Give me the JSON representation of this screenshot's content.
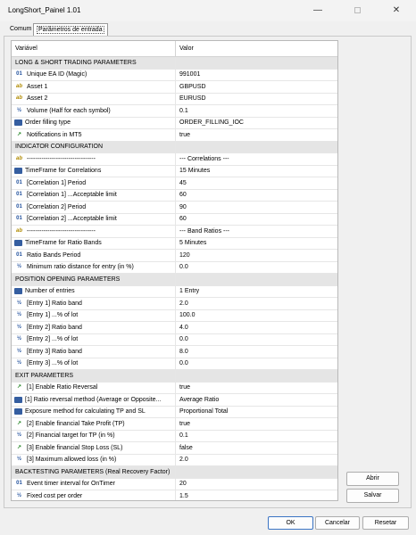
{
  "window": {
    "title": "LongShort_Painel 1.01",
    "minimize_label": "—",
    "close_label": "✕"
  },
  "tabs": [
    "Comum",
    "Parâmetros de entrada"
  ],
  "grid": {
    "headers": {
      "name": "Variável",
      "value": "Valor"
    },
    "rows": [
      {
        "name": "LONG & SHORT TRADING PARAMETERS",
        "value": "",
        "icon": "",
        "section": true
      },
      {
        "name": "Unique EA ID (Magic)",
        "value": "991001",
        "icon": "01"
      },
      {
        "name": "Asset 1",
        "value": "GBPUSD",
        "icon": "ab"
      },
      {
        "name": "Asset 2",
        "value": "EURUSD",
        "icon": "ab"
      },
      {
        "name": "Volume (Half for each symbol)",
        "value": "0.1",
        "icon": "half"
      },
      {
        "name": "Order filling type",
        "value": "ORDER_FILLING_IOC",
        "icon": "enum"
      },
      {
        "name": "Notifications in MT5",
        "value": "true",
        "icon": "bool"
      },
      {
        "name": "INDICATOR CONFIGURATION",
        "value": "",
        "icon": "",
        "section": true
      },
      {
        "name": "---------------------------------",
        "value": "--- Correlations ---",
        "icon": "ab"
      },
      {
        "name": "TimeFrame for Correlations",
        "value": "15 Minutes",
        "icon": "enum"
      },
      {
        "name": "[Correlation 1] Period",
        "value": "45",
        "icon": "01"
      },
      {
        "name": "[Correlation 1] ...Acceptable limit",
        "value": "60",
        "icon": "01"
      },
      {
        "name": "[Correlation 2] Period",
        "value": "90",
        "icon": "01"
      },
      {
        "name": "[Correlation 2] ...Acceptable limit",
        "value": "60",
        "icon": "01"
      },
      {
        "name": "---------------------------------",
        "value": "--- Band Ratios ---",
        "icon": "ab"
      },
      {
        "name": "TimeFrame for Ratio Bands",
        "value": "5 Minutes",
        "icon": "enum"
      },
      {
        "name": "Ratio Bands Period",
        "value": "120",
        "icon": "01"
      },
      {
        "name": "Minimum ratio distance for entry (in %)",
        "value": "0.0",
        "icon": "half"
      },
      {
        "name": "POSITION OPENING PARAMETERS",
        "value": "",
        "icon": "",
        "section": true
      },
      {
        "name": "Number of entries",
        "value": "1 Entry",
        "icon": "enum"
      },
      {
        "name": "[Entry 1] Ratio band",
        "value": "2.0",
        "icon": "half"
      },
      {
        "name": "[Entry 1] ...% of lot",
        "value": "100.0",
        "icon": "half"
      },
      {
        "name": "[Entry 2] Ratio band",
        "value": "4.0",
        "icon": "half"
      },
      {
        "name": "[Entry 2] ...% of lot",
        "value": "0.0",
        "icon": "half"
      },
      {
        "name": "[Entry 3] Ratio band",
        "value": "8.0",
        "icon": "half"
      },
      {
        "name": "[Entry 3] ...% of lot",
        "value": "0.0",
        "icon": "half"
      },
      {
        "name": "EXIT PARAMETERS",
        "value": "",
        "icon": "",
        "section": true
      },
      {
        "name": "[1] Enable Ratio Reversal",
        "value": "true",
        "icon": "bool"
      },
      {
        "name": "[1] Ratio reversal method (Average or Opposite...",
        "value": "Average Ratio",
        "icon": "enum"
      },
      {
        "name": "Exposure method for calculating TP and SL",
        "value": "Proportional Total",
        "icon": "enum"
      },
      {
        "name": "[2] Enable financial Take Profit (TP)",
        "value": "true",
        "icon": "bool"
      },
      {
        "name": "[2] Financial target for TP (in %)",
        "value": "0.1",
        "icon": "half"
      },
      {
        "name": "[3] Enable financial Stop Loss (SL)",
        "value": "false",
        "icon": "bool"
      },
      {
        "name": "[3] Maximum allowed loss (in %)",
        "value": "2.0",
        "icon": "half"
      },
      {
        "name": "BACKTESTING PARAMETERS (Real Recovery Factor)",
        "value": "",
        "icon": "",
        "section": true
      },
      {
        "name": "Event timer interval for OnTimer",
        "value": "20",
        "icon": "01"
      },
      {
        "name": "Fixed cost per order",
        "value": "1.5",
        "icon": "half"
      }
    ]
  },
  "icon_glyphs": {
    "01": "01",
    "ab": "ab",
    "half": "½",
    "bool": "↗",
    "enum": ""
  },
  "side_buttons": {
    "open": "Abrir",
    "save": "Salvar"
  },
  "footer": {
    "ok": "OK",
    "cancel": "Cancelar",
    "reset": "Resetar"
  }
}
